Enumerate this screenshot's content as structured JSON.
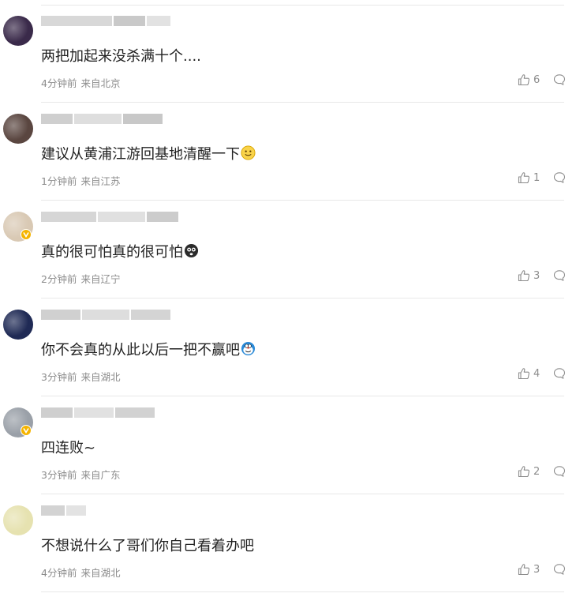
{
  "comments": [
    {
      "text": "两把加起来没杀满十个....",
      "emoji": "",
      "time": "4分钟前",
      "location": "来自北京",
      "likes": "6",
      "verified": false,
      "avatar_color": "#3a2a4a"
    },
    {
      "text": "建议从黄浦江游回基地清醒一下",
      "emoji": "smile-emoji",
      "time": "1分钟前",
      "location": "来自江苏",
      "likes": "1",
      "verified": false,
      "avatar_color": "#5a4640"
    },
    {
      "text": "真的很可怕真的很可怕",
      "emoji": "scared-emoji",
      "time": "2分钟前",
      "location": "来自辽宁",
      "likes": "3",
      "verified": true,
      "avatar_color": "#d9c9b4"
    },
    {
      "text": "你不会真的从此以后一把不赢吧",
      "emoji": "doraemon-emoji",
      "time": "3分钟前",
      "location": "来自湖北",
      "likes": "4",
      "verified": false,
      "avatar_color": "#1f2a55"
    },
    {
      "text": "四连败~",
      "emoji": "",
      "time": "3分钟前",
      "location": "来自广东",
      "likes": "2",
      "verified": true,
      "avatar_color": "#9aa0a8"
    },
    {
      "text": "不想说什么了哥们你自己看着办吧",
      "emoji": "",
      "time": "4分钟前",
      "location": "来自湖北",
      "likes": "3",
      "verified": false,
      "avatar_color": "#e6e2b0"
    }
  ]
}
